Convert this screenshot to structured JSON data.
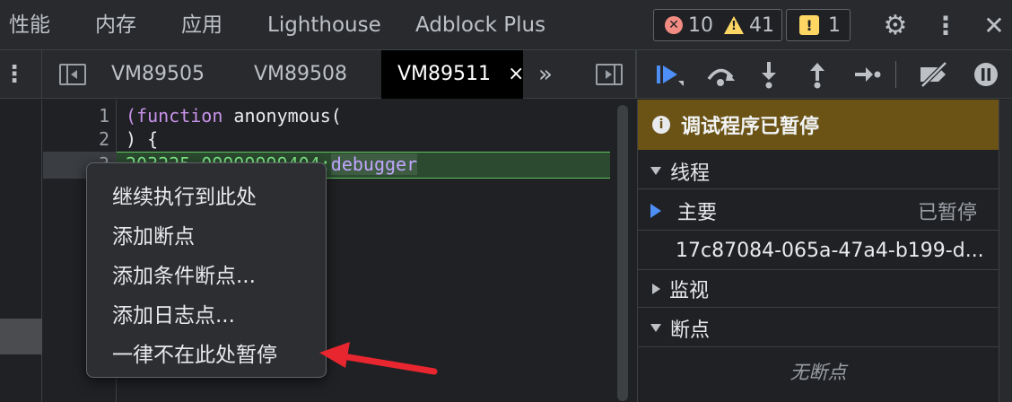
{
  "top_tabs": [
    "性能",
    "内存",
    "应用",
    "Lighthouse",
    "Adblock Plus"
  ],
  "counters": {
    "errors": "10",
    "warnings": "41",
    "issues": "1"
  },
  "file_tabs": [
    "VM89505",
    "VM89508",
    "VM89511"
  ],
  "active_close": "×",
  "more_tabs": "»",
  "code_lines": [
    {
      "num": "1",
      "text": "(function anonymous("
    },
    {
      "num": "2",
      "text": ") {"
    },
    {
      "num": "3",
      "text_a": "203225.09999999404;",
      "text_b": "debugger"
    }
  ],
  "context_menu": [
    "继续执行到此处",
    "添加断点",
    "添加条件断点...",
    "添加日志点...",
    "一律不在此处暂停"
  ],
  "debugger": {
    "paused_message": "调试程序已暂停",
    "threads_label": "线程",
    "main_thread": "主要",
    "main_status": "已暂停",
    "worker_thread": "17c87084-065a-47a4-b199-d...",
    "watch_label": "监视",
    "breakpoints_label": "断点",
    "no_breakpoints": "无断点"
  },
  "colors": {
    "paused_banner": "#6b5316",
    "annotation_arrow": "#e8262f",
    "exec_line": "#2b4a2f"
  }
}
